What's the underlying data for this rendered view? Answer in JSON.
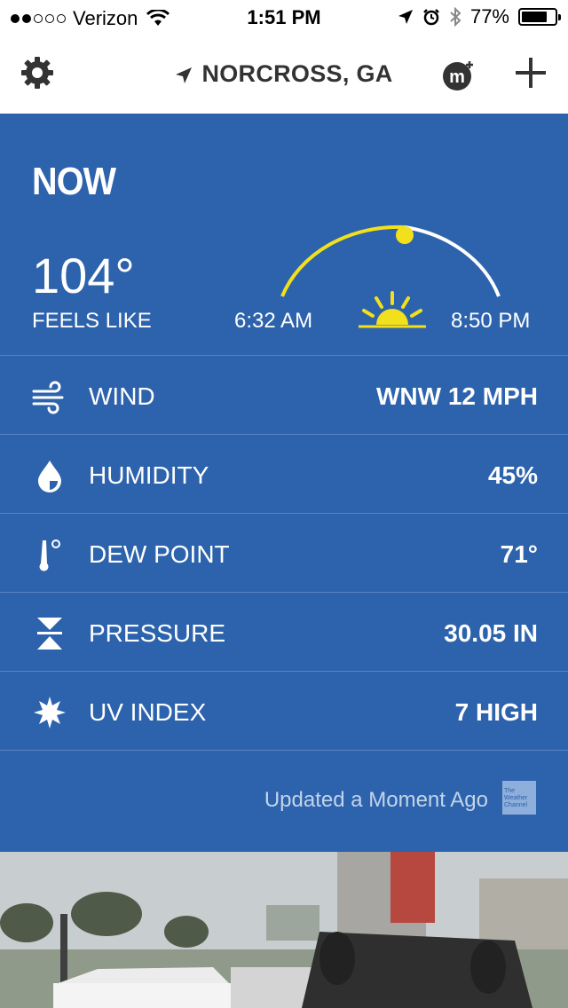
{
  "status_bar": {
    "carrier": "Verizon",
    "time": "1:51 PM",
    "battery_pct": "77%",
    "battery_level": 0.77,
    "signal_bars": 2
  },
  "nav": {
    "location": "NORCROSS, GA",
    "icons": [
      "gear-icon",
      "location-arrow-icon",
      "m-logo-icon",
      "plus-icon"
    ]
  },
  "now": {
    "title": "NOW",
    "temperature": "104°",
    "feels_like_label": "FEELS LIKE",
    "sunrise": "6:32 AM",
    "sunset": "8:50 PM",
    "day_progress": 0.5
  },
  "conditions": [
    {
      "icon": "wind-icon",
      "label": "WIND",
      "value": "WNW 12 MPH"
    },
    {
      "icon": "humidity-drop-icon",
      "label": "HUMIDITY",
      "value": "45%"
    },
    {
      "icon": "dew-point-thermometer-icon",
      "label": "DEW POINT",
      "value": "71°"
    },
    {
      "icon": "pressure-icon",
      "label": "PRESSURE",
      "value": "30.05 IN"
    },
    {
      "icon": "uv-sun-icon",
      "label": "UV INDEX",
      "value": "7 HIGH"
    }
  ],
  "updated": {
    "text": "Updated a Moment Ago",
    "logo_text": "The Weather Channel"
  },
  "colors": {
    "panel_bg": "#2d63ac",
    "sun_yellow": "#f2e01d"
  }
}
